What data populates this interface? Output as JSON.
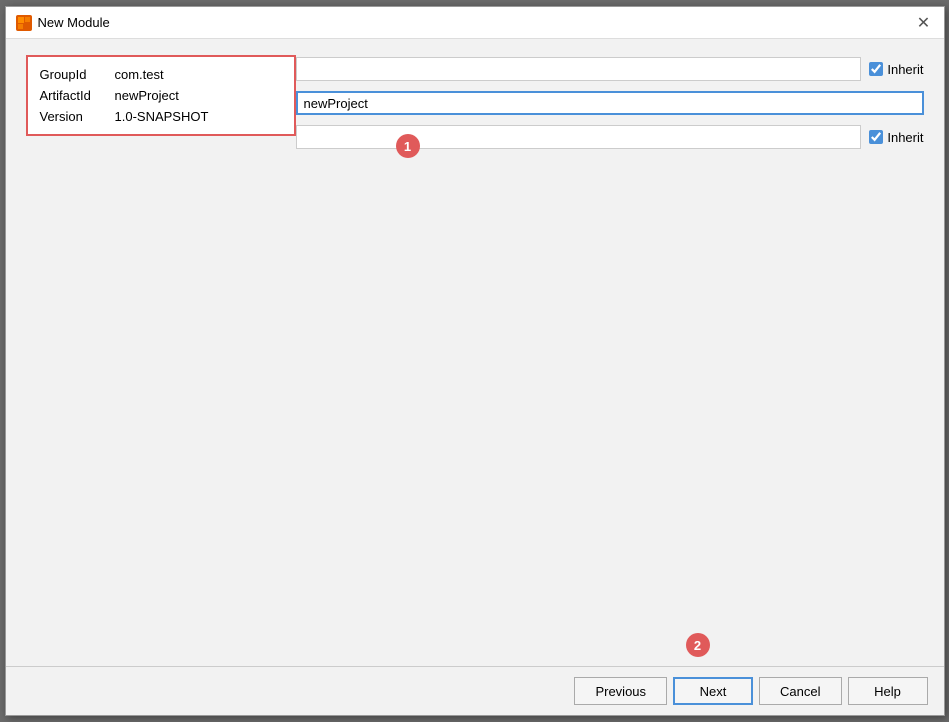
{
  "dialog": {
    "title": "New Module",
    "icon_label": "M"
  },
  "form": {
    "group_id_label": "GroupId",
    "group_id_value": "com.test",
    "artifact_id_label": "ArtifactId",
    "artifact_id_value": "newProject",
    "version_label": "Version",
    "version_value": "1.0-SNAPSHOT",
    "inherit_label": "Inherit"
  },
  "annotations": {
    "badge1": "1",
    "badge2": "2"
  },
  "footer": {
    "previous_label": "Previous",
    "next_label": "Next",
    "cancel_label": "Cancel",
    "help_label": "Help"
  }
}
